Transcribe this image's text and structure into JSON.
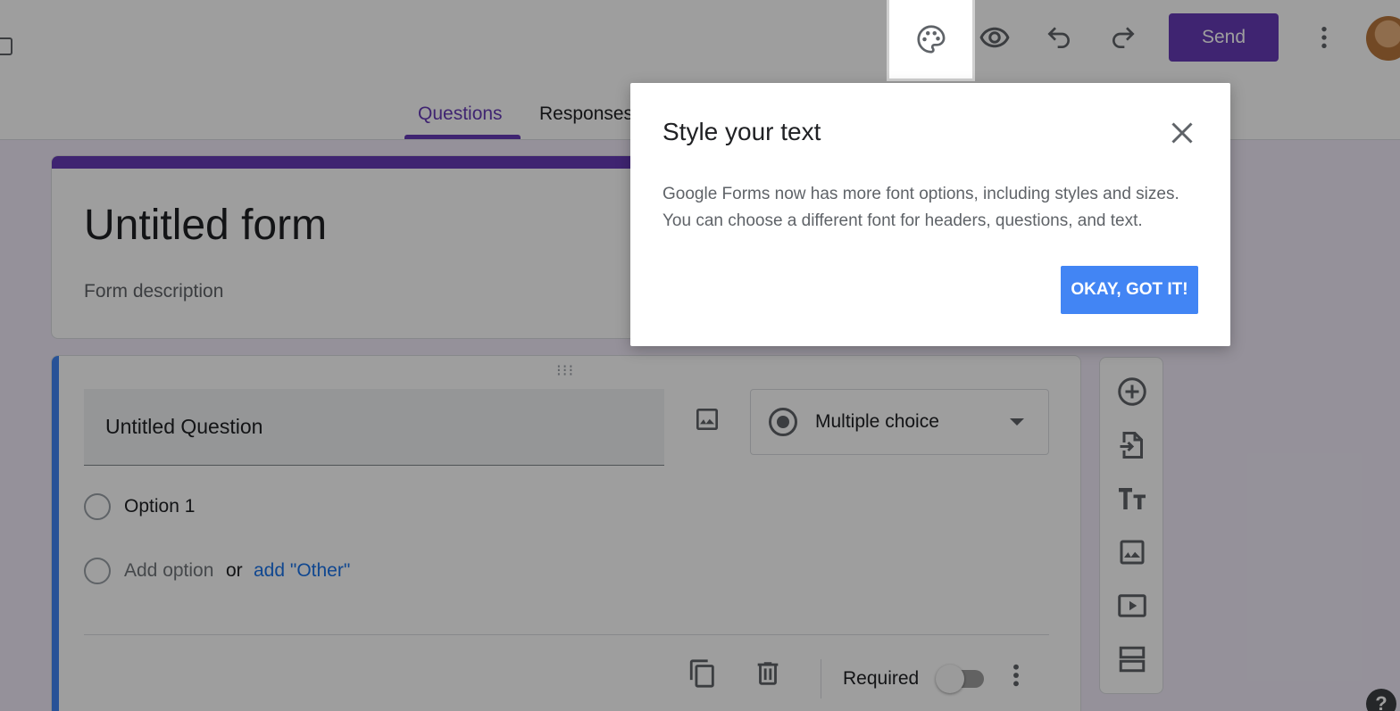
{
  "header": {
    "send_label": "Send",
    "icons": [
      "palette-icon",
      "eye-icon",
      "undo-icon",
      "redo-icon",
      "more-vert-icon"
    ]
  },
  "tabs": [
    {
      "label": "Questions",
      "active": true
    },
    {
      "label": "Responses",
      "active": false
    }
  ],
  "form": {
    "title": "Untitled form",
    "description_placeholder": "Form description"
  },
  "question": {
    "title": "Untitled Question",
    "type": "Multiple choice",
    "options": [
      "Option 1"
    ],
    "add_option": "Add option",
    "or": "or",
    "add_other": "add \"Other\"",
    "required_label": "Required",
    "required": false
  },
  "side_toolbar": {
    "icons": [
      "add-question-icon",
      "import-questions-icon",
      "add-title-icon",
      "add-image-icon",
      "add-video-icon",
      "add-section-icon"
    ]
  },
  "dialog": {
    "title": "Style your text",
    "body_line1": "Google Forms now has more font options, including styles and sizes.",
    "body_line2": "You can choose a different font for headers, questions, and text.",
    "ok_label": "OKAY, GOT IT!"
  },
  "help_label": "?",
  "colors": {
    "accent": "#673ab7",
    "question_bar": "#4285f4",
    "dialog_button": "#4285f4",
    "link": "#1a73e8"
  }
}
